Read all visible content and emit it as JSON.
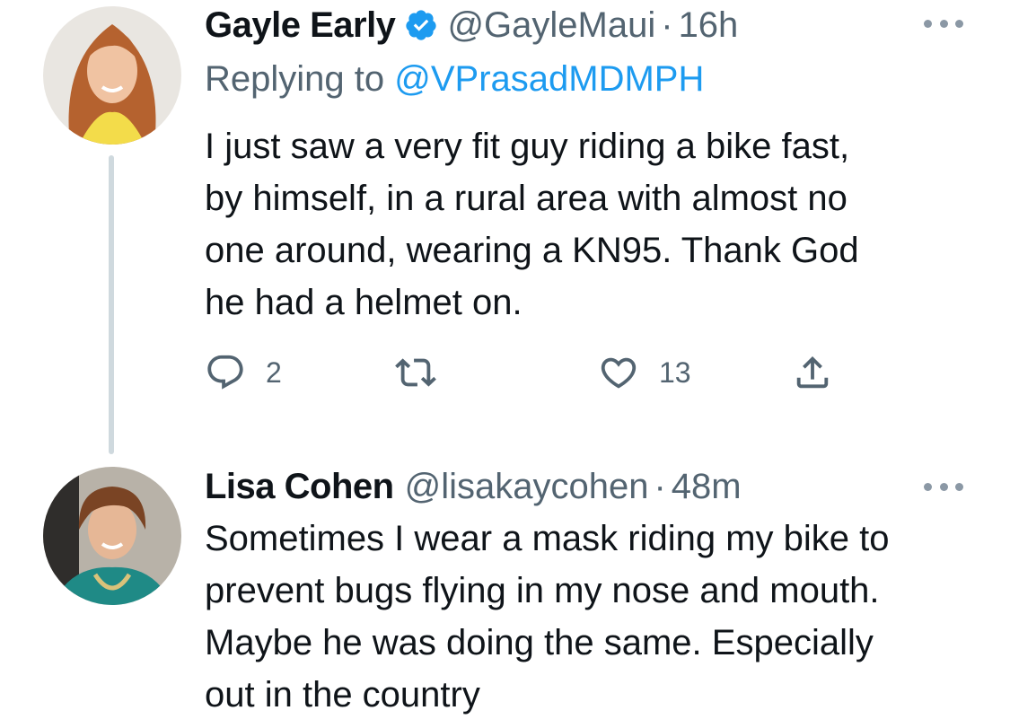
{
  "tweets": [
    {
      "author_name": "Gayle Early",
      "verified": true,
      "handle": "@GayleMaui",
      "separator": "·",
      "time": "16h",
      "replying_prefix": "Replying to ",
      "replying_to": "@VPrasadMDMPH",
      "body_lines": [
        "I just saw a very fit guy riding a bike fast,",
        "by himself, in a rural area with almost no",
        "one around, wearing a KN95. Thank God",
        "he had a helmet on."
      ],
      "actions": {
        "reply_icon": "reply-icon",
        "reply_count": "2",
        "retweet_icon": "retweet-icon",
        "like_icon": "heart-icon",
        "like_count": "13",
        "share_icon": "share-icon"
      }
    },
    {
      "author_name": "Lisa Cohen",
      "verified": false,
      "handle": "@lisakaycohen",
      "separator": "·",
      "time": "48m",
      "body_lines": [
        "Sometimes I wear a mask riding my bike to",
        "prevent bugs flying in my nose and mouth.",
        "Maybe he was doing the same. Especially",
        "out in the country"
      ]
    }
  ],
  "colors": {
    "accent": "#1d9bf0",
    "secondary_text": "#536471",
    "thread_line": "#cfd9de"
  }
}
